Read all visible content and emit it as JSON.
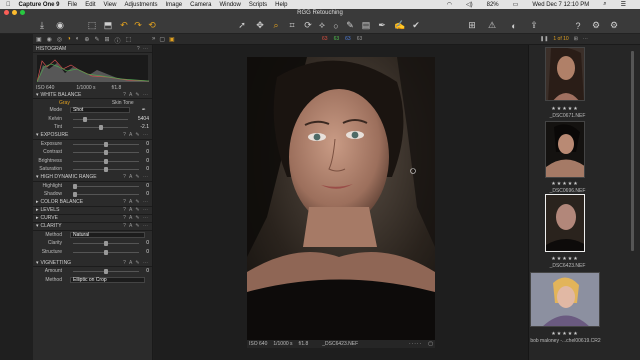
{
  "menubar": {
    "app": "Capture One 9",
    "items": [
      "File",
      "Edit",
      "View",
      "Adjustments",
      "Image",
      "Camera",
      "Window",
      "Scripts",
      "Help"
    ],
    "battery": "82%",
    "datetime": "Wed Dec 7  12:10 PM"
  },
  "window": {
    "title": "RGG Retouching"
  },
  "toolstrip": {
    "counter": "1 of 10"
  },
  "histogram": {
    "title": "HISTOGRAM",
    "iso": "ISO 640",
    "shutter": "1/1000 s",
    "aperture": "f/1.8"
  },
  "white_balance": {
    "title": "WHITE BALANCE",
    "tabs": [
      "Gray",
      "Skin Tone"
    ],
    "mode_label": "Mode",
    "mode_value": "Shot",
    "kelvin_label": "Kelvin",
    "kelvin_value": "5404",
    "tint_label": "Tint",
    "tint_value": "-2.1"
  },
  "exposure": {
    "title": "EXPOSURE",
    "rows": [
      {
        "label": "Exposure",
        "value": "0"
      },
      {
        "label": "Contrast",
        "value": "0"
      },
      {
        "label": "Brightness",
        "value": "0"
      },
      {
        "label": "Saturation",
        "value": "0"
      }
    ]
  },
  "hdr": {
    "title": "HIGH DYNAMIC RANGE",
    "rows": [
      {
        "label": "Highlight",
        "value": "0"
      },
      {
        "label": "Shadow",
        "value": "0"
      }
    ]
  },
  "collapsed": [
    "COLOR BALANCE",
    "LEVELS",
    "CURVE"
  ],
  "clarity": {
    "title": "CLARITY",
    "method_label": "Method",
    "method_value": "Natural",
    "rows": [
      {
        "label": "Clarity",
        "value": "0"
      },
      {
        "label": "Structure",
        "value": "0"
      }
    ]
  },
  "vignetting": {
    "title": "VIGNETTING",
    "amount_label": "Amount",
    "amount_value": "0",
    "method_label": "Method",
    "method_value": "Elliptic on Crop"
  },
  "viewer_info": {
    "iso": "ISO 640",
    "shutter": "1/1000 s",
    "aperture": "f/1.8",
    "filename": "_DSC6423.NEF"
  },
  "browser": {
    "items": [
      {
        "stars": "★★★★★",
        "filename": "_DSC0671.NEF"
      },
      {
        "stars": "★★★★★",
        "filename": "_DSC0696.NEF"
      },
      {
        "stars": "★★★★★",
        "filename": "_DSC6423.NEF"
      },
      {
        "stars": "★★★★★",
        "filename": "bob maloney -...chel00619.CR2"
      }
    ]
  },
  "colors": {
    "accent": "#e0a020",
    "panel": "#2b2b2b"
  }
}
